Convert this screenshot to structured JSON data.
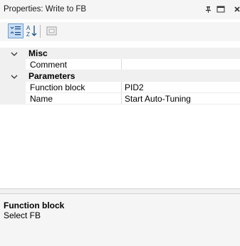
{
  "window": {
    "title": "Properties: Write to FB"
  },
  "toolbar": {
    "buttons": [
      {
        "icon": "categorized-icon",
        "pressed": true
      },
      {
        "icon": "alphabetical-sort-icon",
        "pressed": false
      },
      {
        "icon": "property-pages-icon",
        "enabled": false
      }
    ]
  },
  "grid": {
    "categories": [
      {
        "name": "Misc",
        "expanded": true,
        "properties": [
          {
            "name": "Comment",
            "value": ""
          }
        ]
      },
      {
        "name": "Parameters",
        "expanded": true,
        "properties": [
          {
            "name": "Function block",
            "value": "PID2"
          },
          {
            "name": "Name",
            "value": "Start Auto-Tuning"
          }
        ]
      }
    ]
  },
  "description": {
    "title": "Function block",
    "text": "Select FB"
  },
  "colors": {
    "pressed_button_bg": "#c9ddf2",
    "pressed_button_border": "#6a9fd6",
    "category_bg": "#f0f0f0",
    "panel_bg": "#f5f5f5"
  }
}
